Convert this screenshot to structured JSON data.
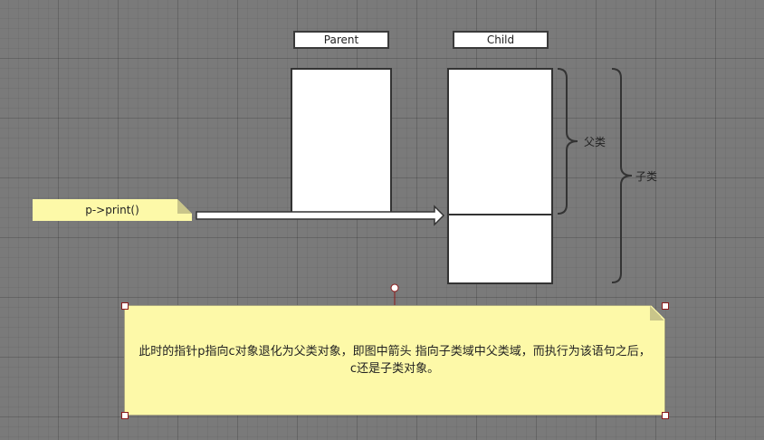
{
  "parent_label": "Parent",
  "child_label": "Child",
  "call_note": "p->print()",
  "brace_parent_label": "父类",
  "brace_child_label": "子类",
  "description": "此时的指针p指向c对象退化为父类对象，即图中箭头 指向子类域中父类域，而执行为该语句之后，c还是子类对象。"
}
